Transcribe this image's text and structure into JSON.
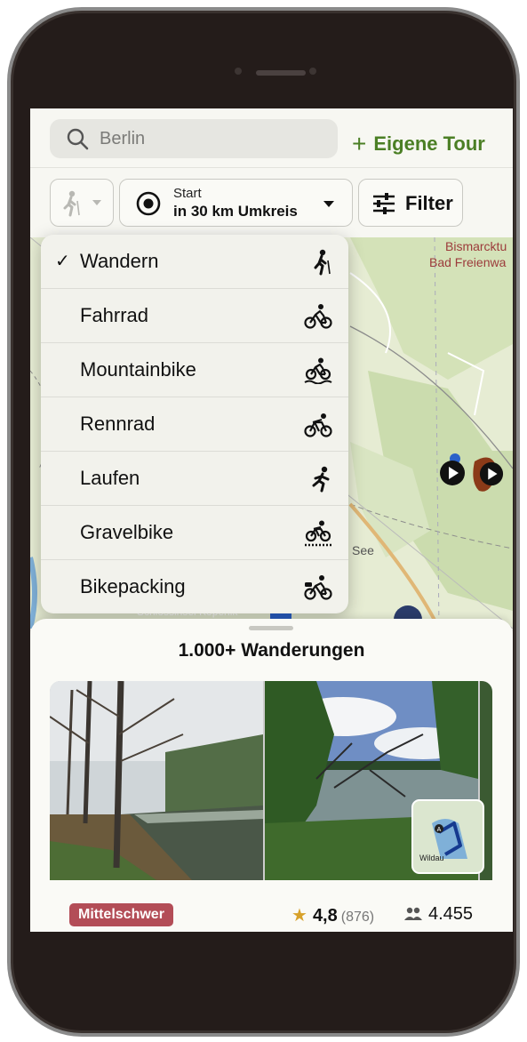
{
  "search": {
    "value": "Berlin"
  },
  "header": {
    "own_tour_label": "Eigene Tour"
  },
  "filters": {
    "start_line": "Start",
    "radius_line": "in 30 km Umkreis",
    "filter_label": "Filter"
  },
  "map": {
    "labels": [
      "Bismarcktu",
      "Bad Freienwa",
      "See",
      "Schlossinsel Köpenik"
    ]
  },
  "activity_menu": {
    "selected": "Wandern",
    "items": [
      {
        "label": "Wandern",
        "icon": "hiking-icon",
        "checked": true
      },
      {
        "label": "Fahrrad",
        "icon": "bike-icon"
      },
      {
        "label": "Mountainbike",
        "icon": "mountainbike-icon"
      },
      {
        "label": "Rennrad",
        "icon": "roadbike-icon"
      },
      {
        "label": "Laufen",
        "icon": "running-icon"
      },
      {
        "label": "Gravelbike",
        "icon": "gravelbike-icon"
      },
      {
        "label": "Bikepacking",
        "icon": "bikepacking-icon"
      }
    ]
  },
  "results": {
    "title": "1.000+ Wanderungen",
    "tour": {
      "difficulty": "Mittelschwer",
      "rating": "4,8",
      "rating_count": "(876)",
      "visitors": "4.455",
      "map_thumb_label": "Wildau"
    }
  },
  "colors": {
    "accent_green": "#4b7f25",
    "difficulty_badge": "#b34d57",
    "star": "#d7a12a"
  }
}
